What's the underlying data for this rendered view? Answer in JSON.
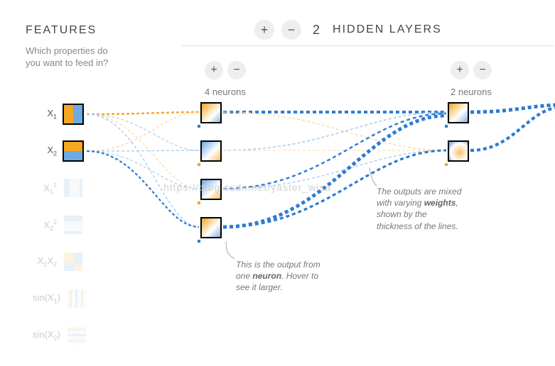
{
  "features": {
    "title": "FEATURES",
    "subtitle": "Which properties do you want to feed in?",
    "items": [
      {
        "label_html": "X<sub>1</sub>",
        "active": true
      },
      {
        "label_html": "X<sub>2</sub>",
        "active": true
      },
      {
        "label_html": "X<sub>1</sub><sup>2</sup>",
        "active": false
      },
      {
        "label_html": "X<sub>2</sub><sup>2</sup>",
        "active": false
      },
      {
        "label_html": "X<sub>1</sub>X<sub>2</sub>",
        "active": false
      },
      {
        "label_html": "sin(X<sub>1</sub>)",
        "active": false
      },
      {
        "label_html": "sin(X<sub>2</sub>)",
        "active": false
      }
    ]
  },
  "hidden": {
    "plus": "+",
    "minus": "−",
    "count": "2",
    "label": "HIDDEN LAYERS"
  },
  "layers": [
    {
      "plus": "+",
      "minus": "−",
      "neurons_label": "4 neurons",
      "neurons": 4
    },
    {
      "plus": "+",
      "minus": "−",
      "neurons_label": "2 neurons",
      "neurons": 2
    }
  ],
  "annotations": {
    "neuron_output": "This is the output from one <b>neuron</b>. Hover to see it larger.",
    "weights": "The outputs are mixed with varying <b>weights</b>, shown by the thickness of the lines."
  },
  "watermark": "https://blog.csdn.net/yaster_wisa",
  "colors": {
    "orange": "#f5a623",
    "light_orange": "#fcd9a8",
    "blue": "#2e7bd1",
    "light_blue": "#a9cdee"
  }
}
